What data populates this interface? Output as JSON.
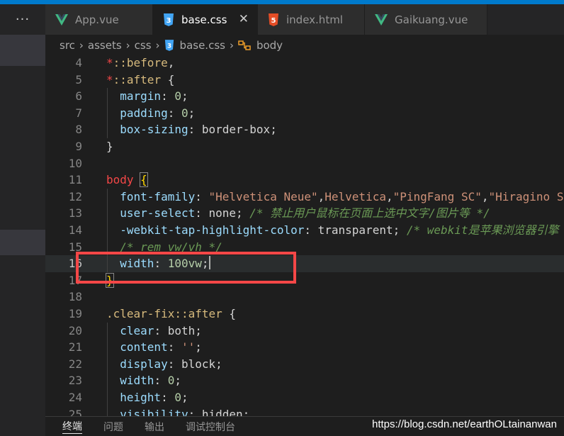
{
  "tabs": [
    {
      "label": "App.vue",
      "icon": "vue-icon"
    },
    {
      "label": "base.css",
      "icon": "css-icon",
      "active": true
    },
    {
      "label": "index.html",
      "icon": "html-icon"
    },
    {
      "label": "Gaikuang.vue",
      "icon": "vue-icon"
    }
  ],
  "more_label": "···",
  "close_label": "✕",
  "breadcrumb": [
    "src",
    "assets",
    "css",
    "base.css",
    "body"
  ],
  "breadcrumb_sep": "›",
  "lines": [
    {
      "n": "4",
      "tokens": [
        {
          "t": "*",
          "c": "star"
        },
        {
          "t": "::before",
          "c": "sel"
        },
        {
          "t": ",",
          "c": "pun"
        }
      ]
    },
    {
      "n": "5",
      "tokens": [
        {
          "t": "*",
          "c": "star"
        },
        {
          "t": "::after",
          "c": "sel"
        },
        {
          "t": " {",
          "c": "pun"
        }
      ]
    },
    {
      "n": "6",
      "tokens": [
        {
          "t": "  "
        },
        {
          "t": "margin",
          "c": "prop"
        },
        {
          "t": ": ",
          "c": "pun"
        },
        {
          "t": "0",
          "c": "num"
        },
        {
          "t": ";",
          "c": "pun"
        }
      ]
    },
    {
      "n": "7",
      "tokens": [
        {
          "t": "  "
        },
        {
          "t": "padding",
          "c": "prop"
        },
        {
          "t": ": ",
          "c": "pun"
        },
        {
          "t": "0",
          "c": "num"
        },
        {
          "t": ";",
          "c": "pun"
        }
      ]
    },
    {
      "n": "8",
      "tokens": [
        {
          "t": "  "
        },
        {
          "t": "box-sizing",
          "c": "prop"
        },
        {
          "t": ": ",
          "c": "pun"
        },
        {
          "t": "border-box",
          "c": "val"
        },
        {
          "t": ";",
          "c": "pun"
        }
      ]
    },
    {
      "n": "9",
      "tokens": [
        {
          "t": "}",
          "c": "pun"
        }
      ]
    },
    {
      "n": "10",
      "tokens": []
    },
    {
      "n": "11",
      "tokens": [
        {
          "t": "body",
          "c": "sel-body"
        },
        {
          "t": " "
        },
        {
          "t": "{",
          "c": "bracket-hl"
        }
      ]
    },
    {
      "n": "12",
      "tokens": [
        {
          "t": "  "
        },
        {
          "t": "font-family",
          "c": "prop"
        },
        {
          "t": ": ",
          "c": "pun"
        },
        {
          "t": "\"Helvetica Neue\"",
          "c": "str"
        },
        {
          "t": ",",
          "c": "pun"
        },
        {
          "t": "Helvetica",
          "c": "str"
        },
        {
          "t": ",",
          "c": "pun"
        },
        {
          "t": "\"PingFang SC\"",
          "c": "str"
        },
        {
          "t": ",",
          "c": "pun"
        },
        {
          "t": "\"Hiragino Sa",
          "c": "str"
        }
      ]
    },
    {
      "n": "13",
      "tokens": [
        {
          "t": "  "
        },
        {
          "t": "user-select",
          "c": "prop"
        },
        {
          "t": ": ",
          "c": "pun"
        },
        {
          "t": "none",
          "c": "val"
        },
        {
          "t": "; ",
          "c": "pun"
        },
        {
          "t": "/* 禁止用户鼠标在页面上选中文字/图片等 */",
          "c": "com"
        }
      ]
    },
    {
      "n": "14",
      "tokens": [
        {
          "t": "  "
        },
        {
          "t": "-webkit-tap-highlight-color",
          "c": "prop"
        },
        {
          "t": ": ",
          "c": "pun"
        },
        {
          "t": "transparent",
          "c": "val"
        },
        {
          "t": "; ",
          "c": "pun"
        },
        {
          "t": "/* webkit是苹果浏览器引擎",
          "c": "com"
        }
      ]
    },
    {
      "n": "15",
      "tokens": [
        {
          "t": "  "
        },
        {
          "t": "/* rem vw/vh */",
          "c": "com"
        }
      ]
    },
    {
      "n": "16",
      "tokens": [
        {
          "t": "  "
        },
        {
          "t": "width",
          "c": "prop"
        },
        {
          "t": ": ",
          "c": "pun"
        },
        {
          "t": "100vw",
          "c": "num"
        },
        {
          "t": ";",
          "c": "pun"
        }
      ],
      "cursor": true,
      "current": true
    },
    {
      "n": "17",
      "tokens": [
        {
          "t": "}",
          "c": "bracket-hl"
        }
      ]
    },
    {
      "n": "18",
      "tokens": []
    },
    {
      "n": "19",
      "tokens": [
        {
          "t": ".clear-fix::after",
          "c": "sel"
        },
        {
          "t": " {",
          "c": "pun"
        }
      ]
    },
    {
      "n": "20",
      "tokens": [
        {
          "t": "  "
        },
        {
          "t": "clear",
          "c": "prop"
        },
        {
          "t": ": ",
          "c": "pun"
        },
        {
          "t": "both",
          "c": "val"
        },
        {
          "t": ";",
          "c": "pun"
        }
      ]
    },
    {
      "n": "21",
      "tokens": [
        {
          "t": "  "
        },
        {
          "t": "content",
          "c": "prop"
        },
        {
          "t": ": ",
          "c": "pun"
        },
        {
          "t": "''",
          "c": "str"
        },
        {
          "t": ";",
          "c": "pun"
        }
      ]
    },
    {
      "n": "22",
      "tokens": [
        {
          "t": "  "
        },
        {
          "t": "display",
          "c": "prop"
        },
        {
          "t": ": ",
          "c": "pun"
        },
        {
          "t": "block",
          "c": "val"
        },
        {
          "t": ";",
          "c": "pun"
        }
      ]
    },
    {
      "n": "23",
      "tokens": [
        {
          "t": "  "
        },
        {
          "t": "width",
          "c": "prop"
        },
        {
          "t": ": ",
          "c": "pun"
        },
        {
          "t": "0",
          "c": "num"
        },
        {
          "t": ";",
          "c": "pun"
        }
      ]
    },
    {
      "n": "24",
      "tokens": [
        {
          "t": "  "
        },
        {
          "t": "height",
          "c": "prop"
        },
        {
          "t": ": ",
          "c": "pun"
        },
        {
          "t": "0",
          "c": "num"
        },
        {
          "t": ";",
          "c": "pun"
        }
      ]
    },
    {
      "n": "25",
      "tokens": [
        {
          "t": "  "
        },
        {
          "t": "visibility",
          "c": "prop"
        },
        {
          "t": ": ",
          "c": "pun"
        },
        {
          "t": "hidden",
          "c": "val"
        },
        {
          "t": ";",
          "c": "pun"
        }
      ]
    }
  ],
  "panel_tabs": [
    "终端",
    "问题",
    "输出",
    "调试控制台"
  ],
  "watermark": "https://blog.csdn.net/earthOLtainanwan",
  "colors": {
    "accent": "#007acc",
    "highlight_box": "#f44747",
    "vue": "#41b883",
    "css": "#42a5f5",
    "html": "#e44d26"
  }
}
